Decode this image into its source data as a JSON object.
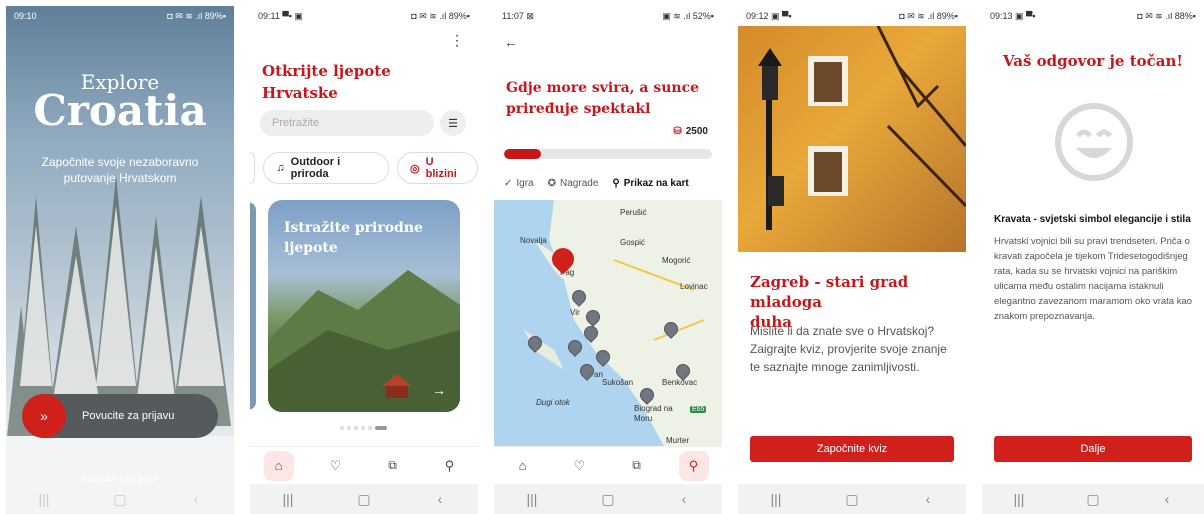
{
  "screen1": {
    "time": "09:10",
    "status": "◘ ✉ ≋ .ıl 89%▪",
    "explore": "Explore",
    "croatia": "Croatia",
    "tagline": "Započnite svoje nezaboravno putovanje Hrvatskom",
    "swipe_label": "Povucite za prijavu",
    "guest_label": "Nastavi kao gost"
  },
  "screen2": {
    "time": "09:11 ▀▪ ▣",
    "status": "◘ ✉ ≋ .ıl 89%▪",
    "title_line1": "Otkrijte ljepote",
    "title_line2": "Hrvatske",
    "search_placeholder": "Pretražite",
    "chip1": "Outdoor i priroda",
    "chip2": "U blizini",
    "card_title_line1": "Istražite prirodne",
    "card_title_line2": "ljepote"
  },
  "screen3": {
    "time": "11:07 ⊠",
    "status": "▣ ≋ .ıl 52%▪",
    "title_line1": "Gdje more svira, a sunce",
    "title_line2": "priređuje spektakl",
    "points": "2500",
    "progress": 0.18,
    "tab1": "Igra",
    "tab2": "Nagrade",
    "tab3": "Prikaz na kart",
    "map_labels": [
      "Perušić",
      "Novalja",
      "Gospić",
      "Pag",
      "Mogorić",
      "Lovinac",
      "Vir",
      "Sukošan",
      "Benkovac",
      "Dugi otok",
      "Biograd na Moru",
      "Murter",
      "E65",
      "an"
    ]
  },
  "screen4": {
    "time": "09:12 ▣ ▀▪",
    "status": "◘ ✉ ≋ .ıl 89%▪",
    "title_line1": "Zagreb - stari grad mladoga",
    "title_line2": "duha",
    "body": "Mislite li da znate sve o Hrvatskoj? Zaigrajte kviz, provjerite svoje znanje te saznajte mnoge zanimljivosti.",
    "button": "Započnite kviz"
  },
  "screen5": {
    "time": "09:13 ▣ ▀▪",
    "status": "◘ ✉ ≋ .ıl 88%▪",
    "result": "Vaš odgovor je točan!",
    "fact_title": "Kravata - svjetski simbol elegancije i stila",
    "fact_body": "Hrvatski vojnici bili su pravi trendseteri. Priča o kravati započela je tijekom Tridesetogodišnjeg rata, kada su se hrvatski vojnici na pariškim ulicama među ostalim nacijama istaknuli elegantno zavezanom maramom oko vrata kao znakom prepoznavanja.",
    "button": "Dalje"
  },
  "nav": {
    "recent": "|||",
    "home": "▢",
    "back": "‹"
  },
  "colors": {
    "accent": "#d0201b",
    "title_red": "#c8171b",
    "map_water": "#aed4ef",
    "map_land": "#eef1e6"
  }
}
